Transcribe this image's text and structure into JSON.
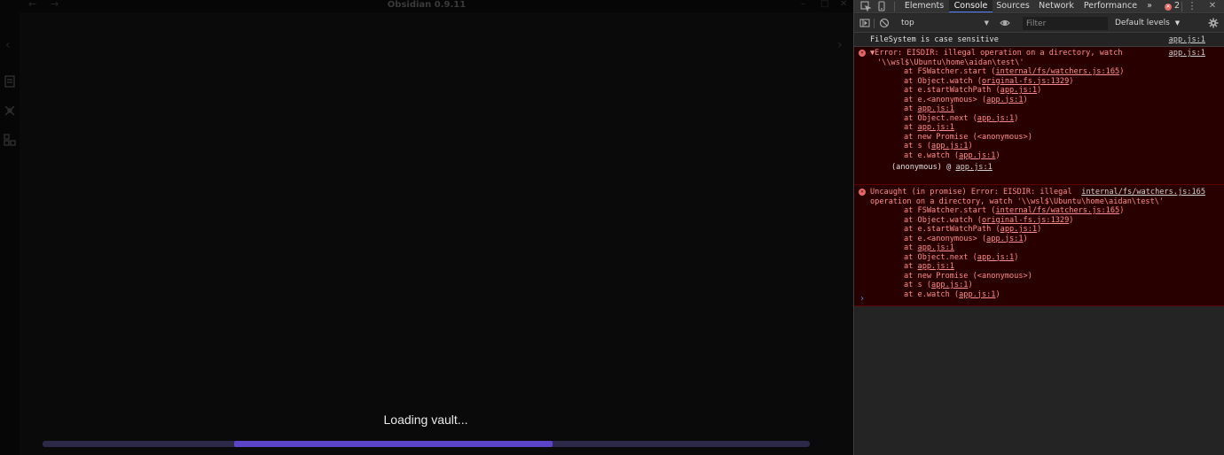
{
  "app": {
    "window_title": "Obsidian 0.9.11",
    "back_glyph": "←",
    "forward_glyph": "→",
    "left_chevron": "‹",
    "right_chevron": "›",
    "loading_text": "Loading vault...",
    "progress": {
      "start_fraction": 0.25,
      "end_fraction": 0.665,
      "track_color": "#2c2948",
      "fill_color": "#5b44c8"
    },
    "ribbon_icons": [
      "file-explorer-icon",
      "command-palette-icon",
      "graph-icon"
    ]
  },
  "devtools": {
    "tabs": [
      "Elements",
      "Console",
      "Sources",
      "Network",
      "Performance"
    ],
    "active_tab": "Console",
    "more_tabs_glyph": "»",
    "error_count": "2",
    "close_glyph": "✕",
    "context": "top",
    "filter_placeholder": "Filter",
    "levels_label": "Default levels",
    "messages": {
      "info": {
        "text": "FileSystem is case sensitive",
        "source": "app.js:1"
      },
      "error1": {
        "source": "app.js:1",
        "line1": "▼Error: EISDIR: illegal operation on a directory, watch",
        "line2": "'\\\\wsl$\\Ubuntu\\home\\aidan\\test\\'",
        "stack": [
          {
            "pre": "at FSWatcher.start (",
            "link": "internal/fs/watchers.js:165",
            "post": ")"
          },
          {
            "pre": "at Object.watch (",
            "link": "original-fs.js:1329",
            "post": ")"
          },
          {
            "pre": "at e.startWatchPath (",
            "link": "app.js:1",
            "post": ")"
          },
          {
            "pre": "at e.<anonymous> (",
            "link": "app.js:1",
            "post": ")"
          },
          {
            "pre": "at ",
            "link": "app.js:1",
            "post": ""
          },
          {
            "pre": "at Object.next (",
            "link": "app.js:1",
            "post": ")"
          },
          {
            "pre": "at ",
            "link": "app.js:1",
            "post": ""
          },
          {
            "pre": "at new Promise (<anonymous>)",
            "link": "",
            "post": ""
          },
          {
            "pre": "at s (",
            "link": "app.js:1",
            "post": ")"
          },
          {
            "pre": "at e.watch (",
            "link": "app.js:1",
            "post": ")"
          }
        ],
        "anon": "(anonymous) @ ",
        "anon_link": "app.js:1"
      },
      "error2": {
        "source": "internal/fs/watchers.js:165",
        "line1": "Uncaught (in promise) Error: EISDIR: illegal",
        "line2": "operation on a directory, watch '\\\\wsl$\\Ubuntu\\home\\aidan\\test\\'",
        "stack": [
          {
            "pre": "at FSWatcher.start (",
            "link": "internal/fs/watchers.js:165",
            "post": ")"
          },
          {
            "pre": "at Object.watch (",
            "link": "original-fs.js:1329",
            "post": ")"
          },
          {
            "pre": "at e.startWatchPath (",
            "link": "app.js:1",
            "post": ")"
          },
          {
            "pre": "at e.<anonymous> (",
            "link": "app.js:1",
            "post": ")"
          },
          {
            "pre": "at ",
            "link": "app.js:1",
            "post": ""
          },
          {
            "pre": "at Object.next (",
            "link": "app.js:1",
            "post": ")"
          },
          {
            "pre": "at ",
            "link": "app.js:1",
            "post": ""
          },
          {
            "pre": "at new Promise (<anonymous>)",
            "link": "",
            "post": ""
          },
          {
            "pre": "at s (",
            "link": "app.js:1",
            "post": ")"
          },
          {
            "pre": "at e.watch (",
            "link": "app.js:1",
            "post": ")"
          }
        ]
      }
    },
    "prompt_glyph": "›"
  }
}
